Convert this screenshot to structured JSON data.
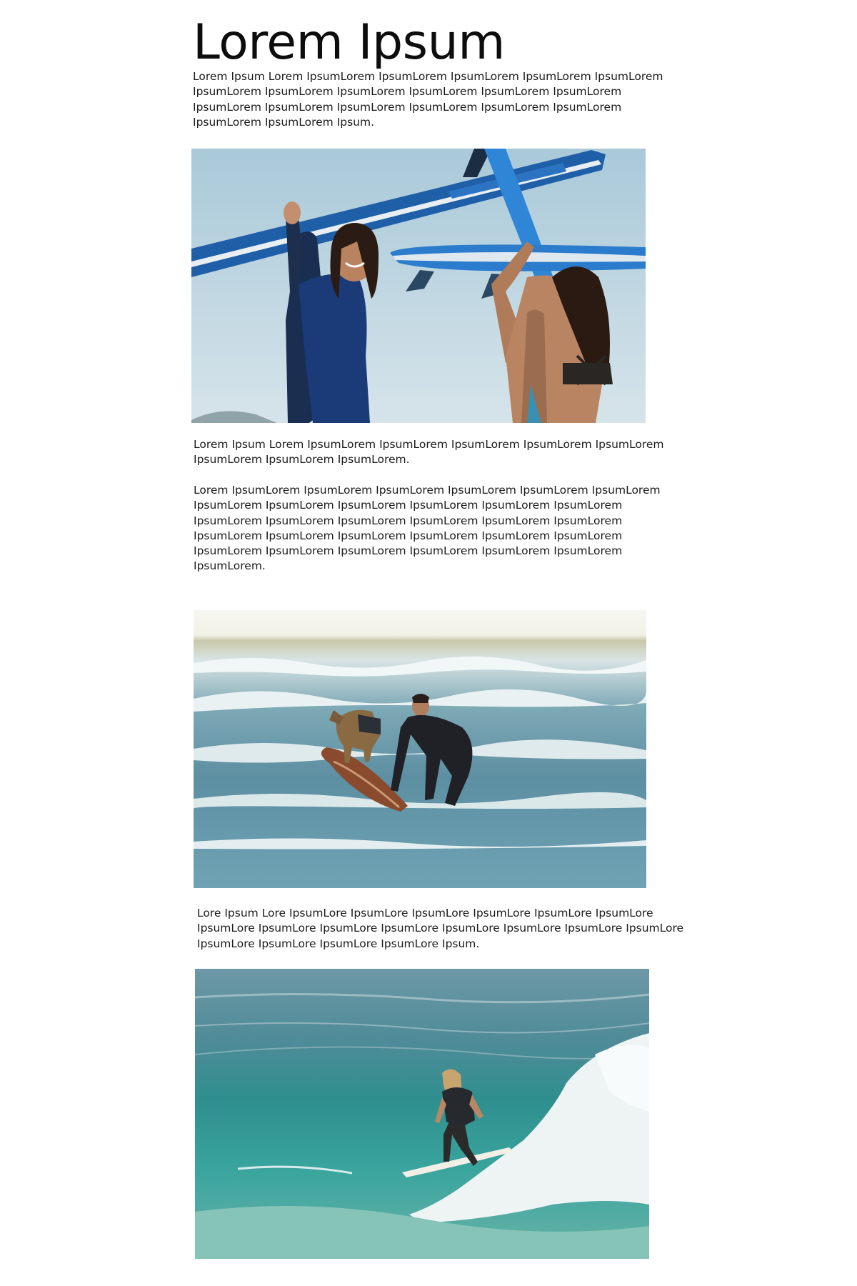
{
  "page": {
    "title": "Lorem Ipsum"
  },
  "paragraphs": {
    "intro": [
      "Lorem Ipsum Lorem IpsumLorem IpsumLorem IpsumLorem IpsumLorem IpsumLorem",
      "IpsumLorem IpsumLorem IpsumLorem IpsumLorem IpsumLorem IpsumLorem",
      "IpsumLorem IpsumLorem IpsumLorem IpsumLorem IpsumLorem IpsumLorem",
      "IpsumLorem IpsumLorem Ipsum."
    ],
    "second": [
      "Lorem Ipsum Lorem IpsumLorem IpsumLorem IpsumLorem IpsumLorem IpsumLorem",
      "IpsumLorem IpsumLorem IpsumLorem."
    ],
    "third": [
      "Lorem IpsumLorem IpsumLorem IpsumLorem IpsumLorem IpsumLorem IpsumLorem",
      "IpsumLorem IpsumLorem IpsumLorem IpsumLorem IpsumLorem IpsumLorem",
      "IpsumLorem IpsumLorem IpsumLorem IpsumLorem IpsumLorem IpsumLorem",
      "IpsumLorem IpsumLorem IpsumLorem IpsumLorem IpsumLorem IpsumLorem",
      "IpsumLorem IpsumLorem IpsumLorem IpsumLorem IpsumLorem IpsumLorem",
      "IpsumLorem."
    ],
    "fourth": [
      "Lore Ipsum Lore IpsumLore IpsumLore IpsumLore IpsumLore IpsumLore IpsumLore",
      "IpsumLore IpsumLore IpsumLore IpsumLore IpsumLore IpsumLore IpsumLore IpsumLore",
      "IpsumLore IpsumLore IpsumLore IpsumLore Ipsum."
    ]
  },
  "images": {
    "surfers_carrying_boards": {
      "icon": "photo-surfers-carrying-boards"
    },
    "surfer_with_dog": {
      "icon": "photo-surfer-with-dog"
    },
    "surfer_riding_wave": {
      "icon": "photo-surfer-riding-wave"
    }
  },
  "colors": {
    "sky": "#b9d3df",
    "board_blue": "#1f5fa8",
    "wetsuit_navy": "#17305a",
    "sea_green": "#3a9c9a",
    "sea_blue": "#5a8fa3",
    "foam": "#eef4f4"
  }
}
